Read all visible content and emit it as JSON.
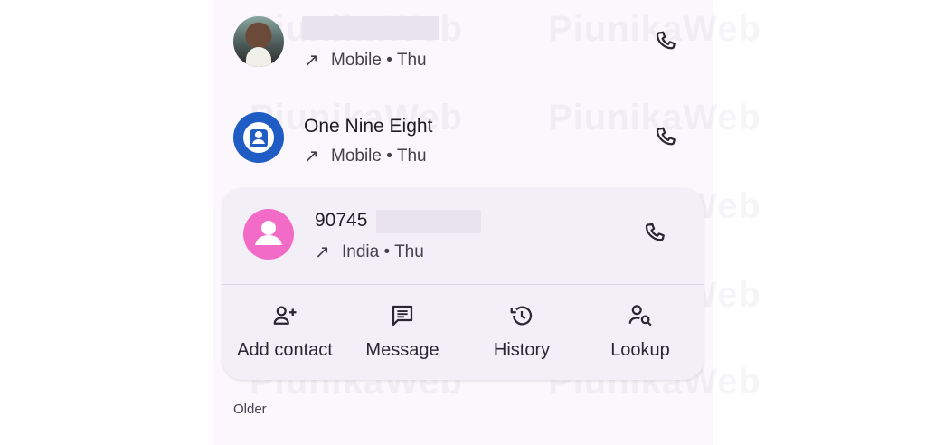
{
  "watermark": "PiunikaWeb",
  "calls": [
    {
      "name": "",
      "direction_icon": "outgoing-arrow-icon",
      "detail": "Mobile • Thu",
      "avatar": "photo",
      "call_icon": "phone-icon"
    },
    {
      "name": "One Nine Eight",
      "direction_icon": "outgoing-arrow-icon",
      "detail": "Mobile • Thu",
      "avatar": "generic-blue",
      "call_icon": "phone-icon"
    },
    {
      "name": "90745",
      "direction_icon": "outgoing-arrow-icon",
      "detail": "India • Thu",
      "avatar": "generic-pink",
      "call_icon": "phone-icon",
      "expanded": true,
      "actions": [
        {
          "label": "Add contact",
          "icon": "add-person-icon"
        },
        {
          "label": "Message",
          "icon": "message-icon"
        },
        {
          "label": "History",
          "icon": "history-icon"
        },
        {
          "label": "Lookup",
          "icon": "person-search-icon"
        }
      ]
    }
  ],
  "section_header": "Older",
  "colors": {
    "background": "#fbf7fc",
    "card": "#f3eff6",
    "blue_avatar": "#1f5cc4",
    "pink_avatar": "#f26bc6"
  }
}
